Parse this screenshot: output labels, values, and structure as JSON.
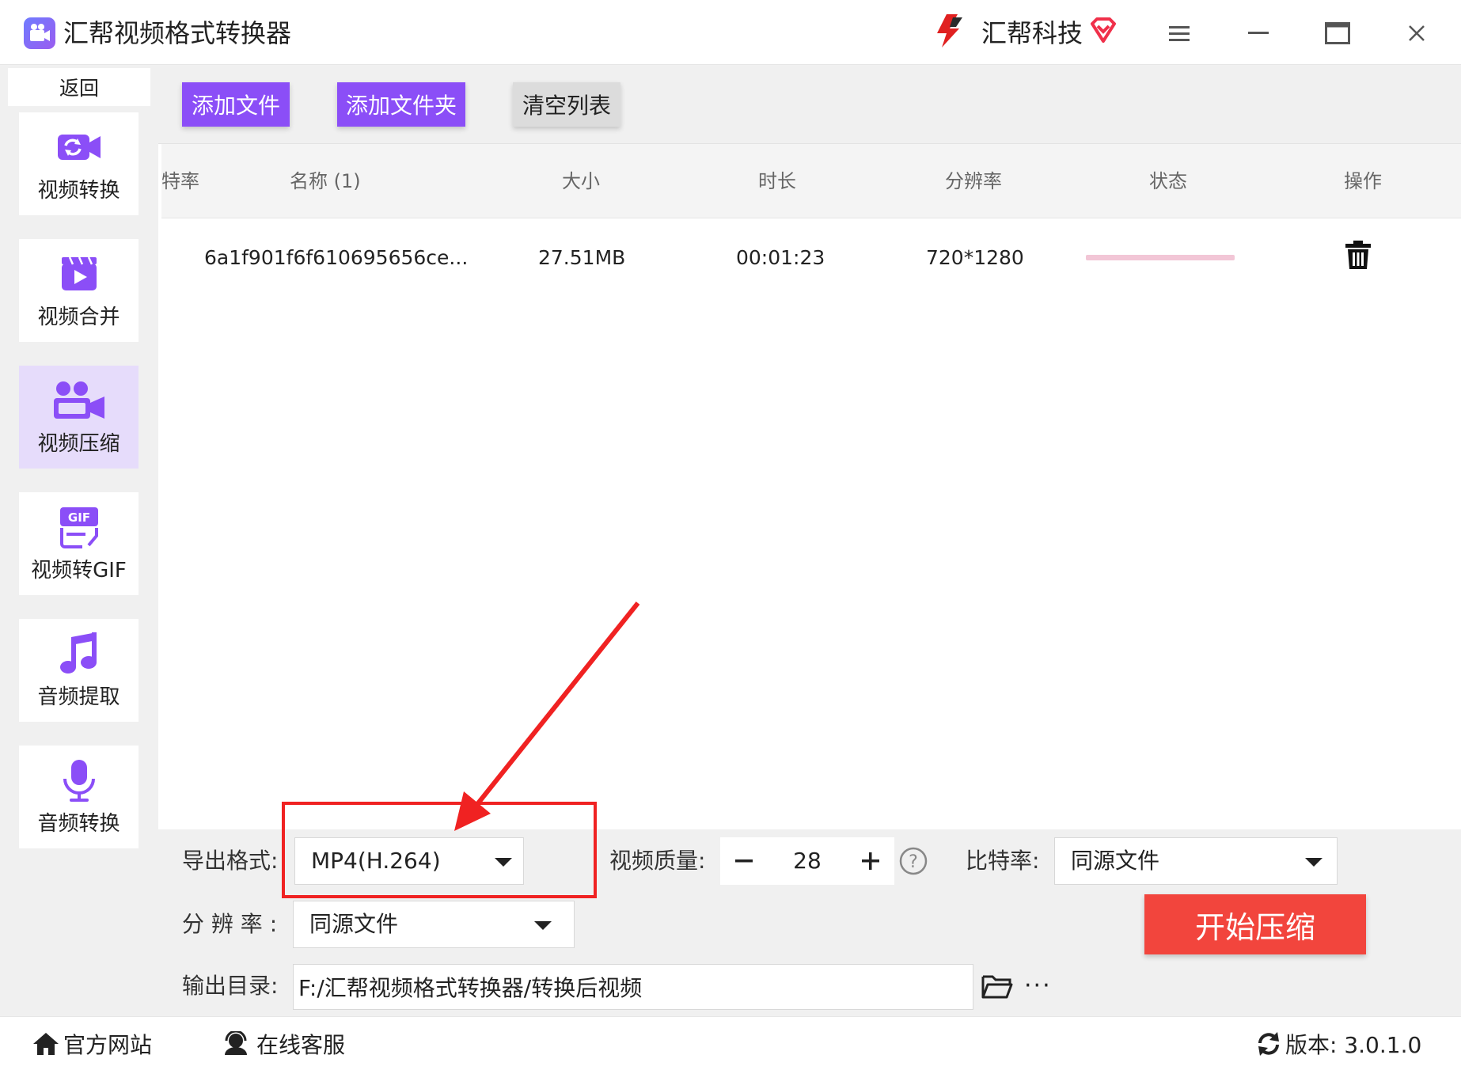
{
  "window": {
    "title": "汇帮视频格式转换器",
    "brand": "汇帮科技",
    "accent": "#8b4ef7"
  },
  "sidebar": {
    "back_label": "返回",
    "items": [
      {
        "label": "视频转换",
        "icon": "video-convert-icon",
        "active": false
      },
      {
        "label": "视频合并",
        "icon": "video-merge-icon",
        "active": false
      },
      {
        "label": "视频压缩",
        "icon": "video-compress-icon",
        "active": true
      },
      {
        "label": "视频转GIF",
        "icon": "gif-icon",
        "active": false
      },
      {
        "label": "音频提取",
        "icon": "music-note-icon",
        "active": false
      },
      {
        "label": "音频转换",
        "icon": "microphone-icon",
        "active": false
      }
    ]
  },
  "toolbar": {
    "add_file": "添加文件",
    "add_folder": "添加文件夹",
    "clear_list": "清空列表"
  },
  "table": {
    "columns": [
      "特率",
      "名称 (1)",
      "大小",
      "时长",
      "分辨率",
      "状态",
      "操作"
    ],
    "rows": [
      {
        "name": "6a1f901f6f610695656ce...",
        "size": "27.51MB",
        "duration": "00:01:23",
        "resolution": "720*1280",
        "status_progress": 0
      }
    ]
  },
  "settings": {
    "format_label": "导出格式:",
    "format_value": "MP4(H.264)",
    "quality_label": "视频质量:",
    "quality_value": "28",
    "bitrate_label": "比特率:",
    "bitrate_value": "同源文件",
    "resolution_label": "分 辨 率 :",
    "resolution_value": "同源文件",
    "outdir_label": "输出目录:",
    "outdir_value": "F:/汇帮视频格式转换器/转换后视频",
    "more_label": "···",
    "start_label": "开始压缩"
  },
  "footer": {
    "site": "官方网站",
    "service": "在线客服",
    "version": "版本: 3.0.1.0"
  },
  "colors": {
    "start_button": "#f2453d",
    "highlight": "#f02222",
    "progress": "#f2c6d6"
  }
}
